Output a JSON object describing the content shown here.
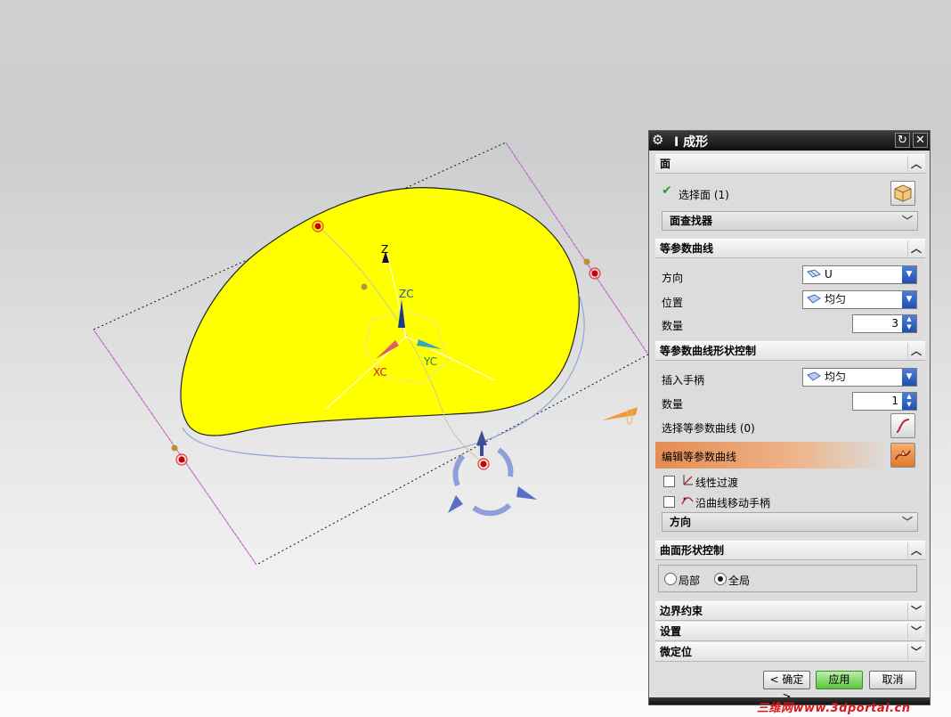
{
  "dialog": {
    "title": "I 成形",
    "sections": {
      "face": {
        "header": "面",
        "select_face_label": "选择面 (1)",
        "face_finder_label": "面查找器"
      },
      "iso_curves": {
        "header": "等参数曲线",
        "direction_label": "方向",
        "direction_value": "U",
        "position_label": "位置",
        "position_value": "均匀",
        "count_label": "数量",
        "count_value": "3"
      },
      "iso_shape_control": {
        "header": "等参数曲线形状控制",
        "insert_handle_label": "插入手柄",
        "insert_handle_value": "均匀",
        "count_label": "数量",
        "count_value": "1",
        "select_iso_label": "选择等参数曲线 (0)",
        "edit_iso_label": "编辑等参数曲线",
        "linear_transition_label": "线性过渡",
        "move_handle_label": "沿曲线移动手柄",
        "direction_bar_label": "方向"
      },
      "surface_shape_control": {
        "header": "曲面形状控制",
        "local_label": "局部",
        "global_label": "全局",
        "selected": "全局"
      },
      "boundary_constraint": {
        "header": "边界约束"
      },
      "settings": {
        "header": "设置"
      },
      "fine_position": {
        "header": "微定位"
      }
    },
    "buttons": {
      "ok": "< 确定 >",
      "apply": "应用",
      "cancel": "取消"
    }
  },
  "viewport": {
    "axis_z": "Z",
    "axis_zc": "ZC",
    "axis_xc": "XC",
    "axis_yc": "YC",
    "axis_z_color": "#000000",
    "axis_zc_color": "#1a5fa8",
    "axis_xc_color": "#d21c1c",
    "axis_yc_color": "#1f7f7f",
    "surface_color": "#ffff00"
  },
  "watermark": "三维网www.3dportal.cn",
  "colors": {
    "title_bar": "#1a1a1a",
    "select_button_accent": "#e8843c",
    "check_green": "#2e9d2e",
    "apply_green": "#5cc23e"
  }
}
